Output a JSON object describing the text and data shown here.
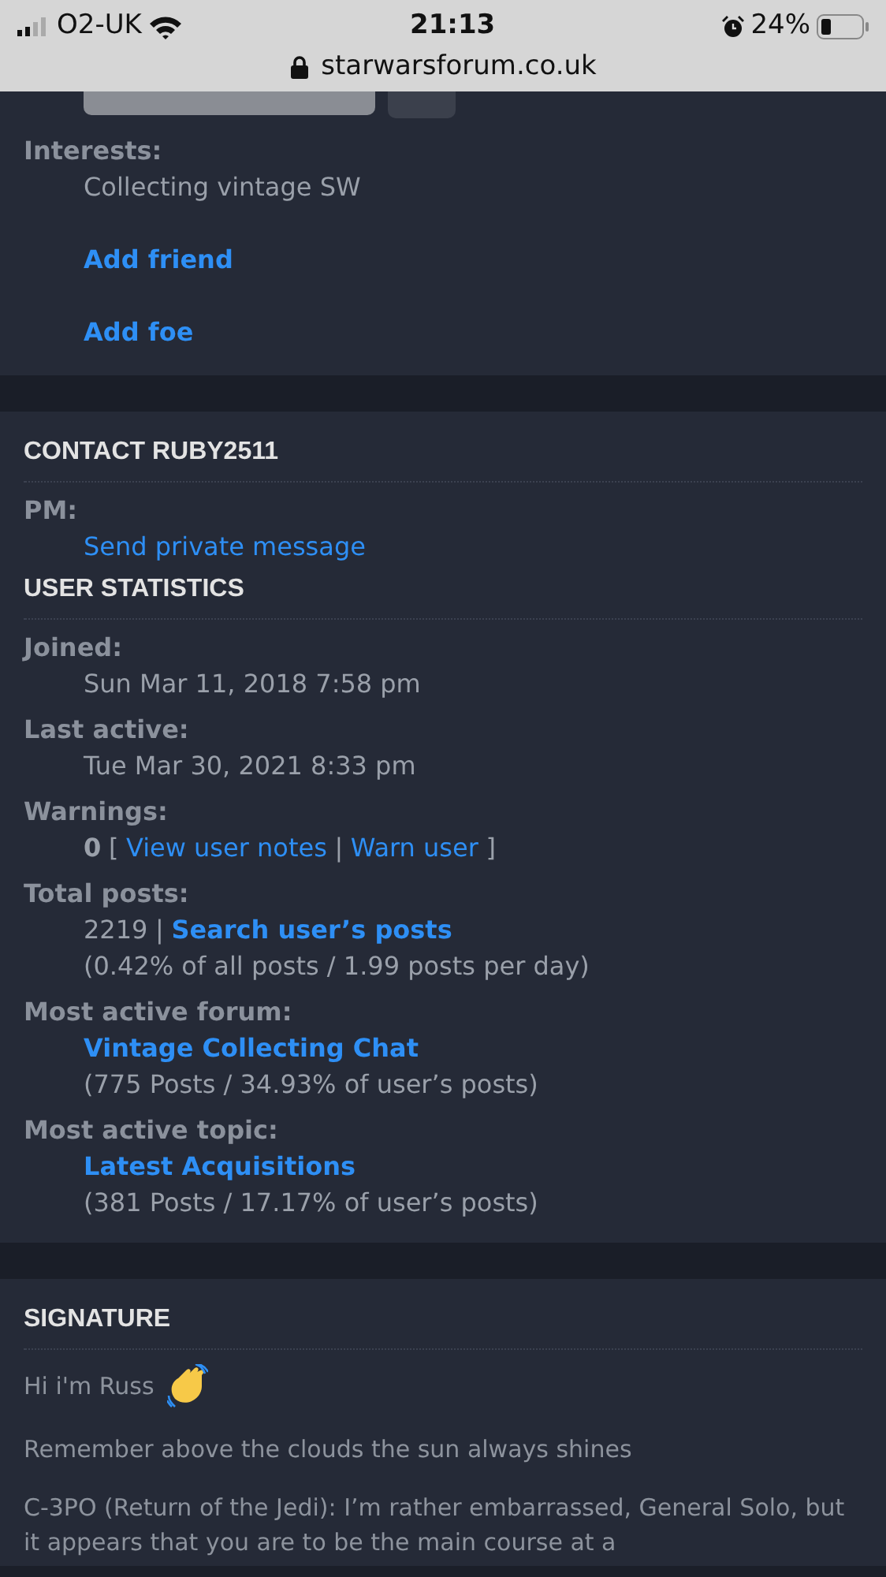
{
  "status_bar": {
    "carrier": "O2-UK",
    "time": "21:13",
    "battery": "24%",
    "url": "starwarsforum.co.uk"
  },
  "profile": {
    "fields": [
      {
        "label": "Interests:",
        "value": "Collecting vintage SW"
      }
    ],
    "actions": [
      "Add friend",
      "Add foe"
    ]
  },
  "contact": {
    "title": "CONTACT RUBY2511",
    "fields": [
      {
        "label": "PM:",
        "lines": [
          [
            {
              "kind": "link",
              "text": "Send private message"
            }
          ]
        ]
      }
    ]
  },
  "statistics": {
    "title": "USER STATISTICS",
    "fields": [
      {
        "label": "Joined:",
        "lines": [
          [
            {
              "kind": "text",
              "text": "Sun Mar 11, 2018 7:58 pm"
            }
          ]
        ]
      },
      {
        "label": "Last active:",
        "lines": [
          [
            {
              "kind": "text",
              "text": "Tue Mar 30, 2021 8:33 pm"
            }
          ]
        ]
      },
      {
        "label": "Warnings:",
        "lines": [
          [
            {
              "kind": "bold",
              "text": "0"
            },
            {
              "kind": "text",
              "text": "["
            },
            {
              "kind": "link",
              "text": "View user notes"
            },
            {
              "kind": "text",
              "text": "|"
            },
            {
              "kind": "link",
              "text": "Warn user"
            },
            {
              "kind": "text",
              "text": "]"
            }
          ]
        ]
      },
      {
        "label": "Total posts:",
        "lines": [
          [
            {
              "kind": "text",
              "text": "2219"
            },
            {
              "kind": "text",
              "text": "|"
            },
            {
              "kind": "bold_link",
              "text": "Search user’s posts"
            }
          ],
          [
            {
              "kind": "text",
              "text": "(0.42% of all posts / 1.99 posts per day)"
            }
          ]
        ]
      },
      {
        "label": "Most active forum:",
        "lines": [
          [
            {
              "kind": "bold_link",
              "text": "Vintage Collecting Chat"
            }
          ],
          [
            {
              "kind": "text",
              "text": "(775 Posts / 34.93% of user’s posts)"
            }
          ]
        ]
      },
      {
        "label": "Most active topic:",
        "lines": [
          [
            {
              "kind": "bold_link",
              "text": "Latest Acquisitions"
            }
          ],
          [
            {
              "kind": "text",
              "text": "(381 Posts / 17.17% of user’s posts)"
            }
          ]
        ]
      }
    ]
  },
  "signature": {
    "title": "SIGNATURE",
    "paragraphs": [
      {
        "text": "Hi i'm Russ",
        "emoji": true
      },
      {
        "text": "Remember above the clouds the sun always shines",
        "emoji": false
      },
      {
        "text": "C-3PO (Return of the Jedi): I’m rather embarrassed, General Solo, but it appears that you are to be the main course at a",
        "emoji": false
      }
    ]
  }
}
